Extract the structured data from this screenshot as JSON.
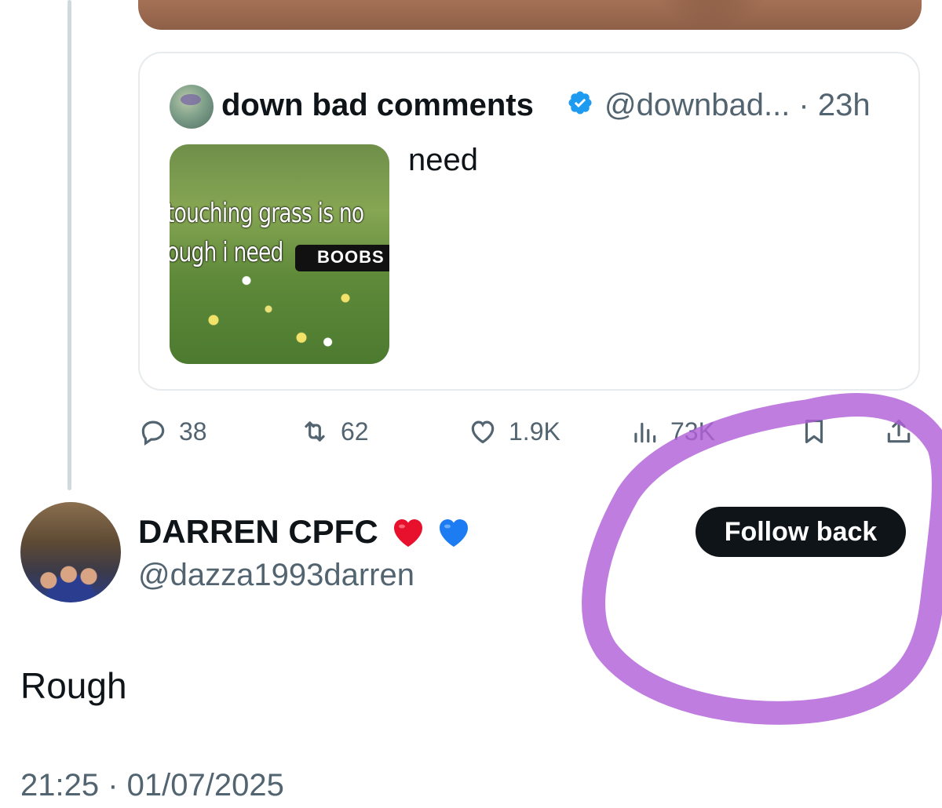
{
  "quoted_tweet": {
    "author_name": "down bad comments",
    "handle_time": "@downbad... · 23h",
    "text": "need",
    "image_text_line1": "touching grass is no",
    "image_text_line2": "ough i need",
    "image_redact_text": "BOOBS"
  },
  "actions": {
    "replies": "38",
    "reposts": "62",
    "likes": "1.9K",
    "views": "73K"
  },
  "reply": {
    "name": "DARREN CPFC",
    "emojis": [
      "red-heart",
      "blue-heart"
    ],
    "handle": "@dazza1993darren",
    "follow_label": "Follow back",
    "text": "Rough",
    "timestamp": "21:25 · 01/07/2025"
  },
  "colors": {
    "text_primary": "#0f1419",
    "text_secondary": "#536471",
    "verified": "#1d9bf0",
    "annotation": "#a855d6",
    "button_bg": "#0f1419"
  }
}
